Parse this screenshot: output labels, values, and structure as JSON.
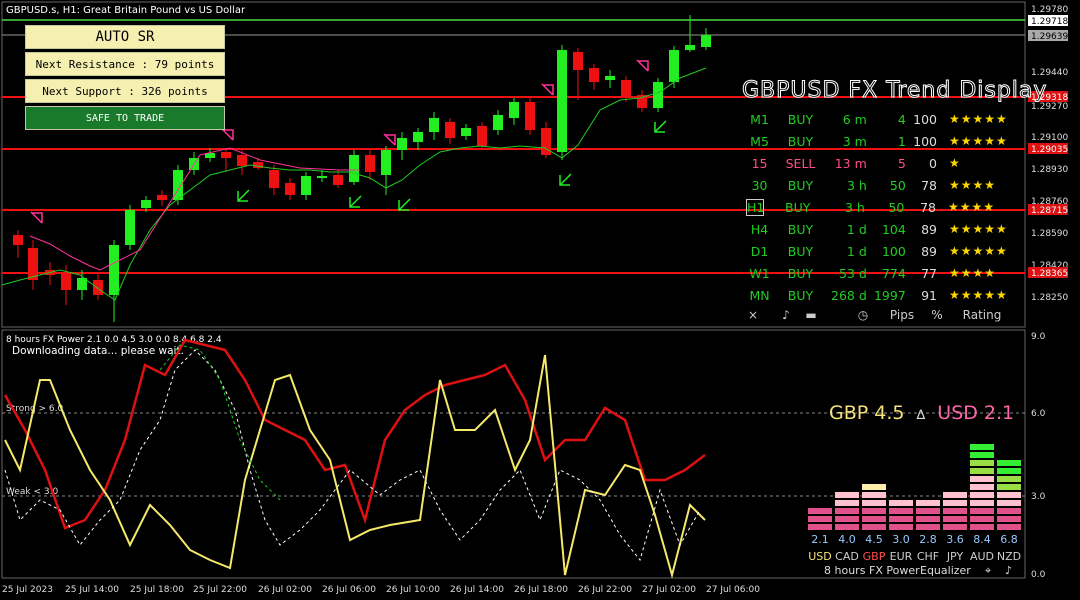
{
  "chart_header": {
    "symbol": "GBPUSD.s, H1:  Great Britain Pound vs US Dollar"
  },
  "auto_sr": {
    "title": "AUTO SR",
    "next_resistance": "Next Resistance : 79 points",
    "next_support": "Next Support : 326 points",
    "status": "SAFE TO TRADE"
  },
  "price_axis": {
    "ticks": [
      "1.29780",
      "1.29440",
      "1.29270",
      "1.29100",
      "1.28930",
      "1.28760",
      "1.28590",
      "1.28420",
      "1.28250"
    ],
    "badges": [
      "1.29718",
      "1.29639",
      "1.29318",
      "1.29035",
      "1.28715",
      "1.28365"
    ]
  },
  "trend_display": {
    "title": "GBPUSD FX Trend Display",
    "rows": [
      {
        "tf": "M1",
        "dir": "BUY",
        "dur": "6 m",
        "pips": "4",
        "pct": "100",
        "stars": "★★★★★"
      },
      {
        "tf": "M5",
        "dir": "BUY",
        "dur": "3 m",
        "pips": "1",
        "pct": "100",
        "stars": "★★★★★"
      },
      {
        "tf": "15",
        "dir": "SELL",
        "dur": "13 m",
        "pips": "5",
        "pct": "0",
        "stars": "★"
      },
      {
        "tf": "30",
        "dir": "BUY",
        "dur": "3 h",
        "pips": "50",
        "pct": "78",
        "stars": "★★★★"
      },
      {
        "tf": "H1",
        "dir": "BUY",
        "dur": "3 h",
        "pips": "50",
        "pct": "78",
        "stars": "★★★★"
      },
      {
        "tf": "H4",
        "dir": "BUY",
        "dur": "1 d",
        "pips": "104",
        "pct": "89",
        "stars": "★★★★★"
      },
      {
        "tf": "D1",
        "dir": "BUY",
        "dur": "1 d",
        "pips": "100",
        "pct": "89",
        "stars": "★★★★★"
      },
      {
        "tf": "W1",
        "dir": "BUY",
        "dur": "53 d",
        "pips": "774",
        "pct": "77",
        "stars": "★★★★"
      },
      {
        "tf": "MN",
        "dir": "BUY",
        "dur": "268 d",
        "pips": "1997",
        "pct": "91",
        "stars": "★★★★★"
      }
    ],
    "footer": {
      "close": "×",
      "sound": "♪",
      "clock": "◷",
      "pips": "Pips",
      "pct": "%",
      "rating": "Rating"
    }
  },
  "fx_power": {
    "header": "8 hours FX Power 2.1 0.0 4.5 3.0 0.0 8.4 6.8 2.4",
    "status": "Downloading data... please wait.",
    "strong_label": "Strong > 6.0",
    "weak_label": "Weak < 3.0",
    "axis_ticks": [
      "9.0",
      "6.0",
      "3.0",
      "0.0"
    ],
    "pair": {
      "base": "GBP 4.5",
      "sep": "∆",
      "quote": "USD 2.1"
    },
    "equalizer": {
      "values": [
        "2.1",
        "4.0",
        "4.5",
        "3.0",
        "2.8",
        "3.6",
        "8.4",
        "6.8"
      ],
      "currencies": [
        "USD",
        "CAD",
        "GBP",
        "EUR",
        "CHF",
        "JPY",
        "AUD",
        "NZD"
      ],
      "footer": [
        "8 hours",
        "FX Power",
        "Equalizer"
      ]
    }
  },
  "time_axis": [
    "25 Jul 2023",
    "25 Jul 14:00",
    "25 Jul 18:00",
    "25 Jul 22:00",
    "26 Jul 02:00",
    "26 Jul 06:00",
    "26 Jul 10:00",
    "26 Jul 14:00",
    "26 Jul 18:00",
    "26 Jul 22:00",
    "27 Jul 02:00",
    "27 Jul 06:00"
  ]
}
